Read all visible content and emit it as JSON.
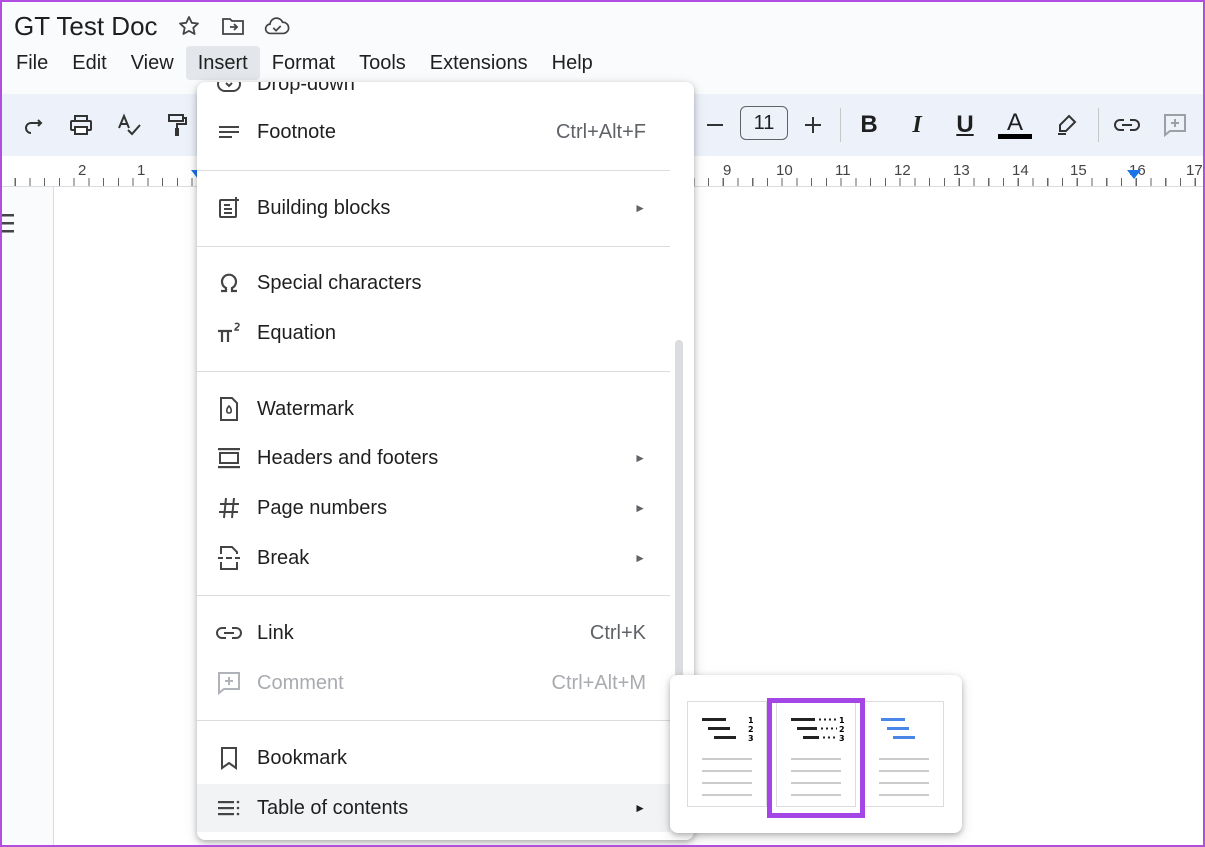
{
  "doc": {
    "title": "GT Test Doc"
  },
  "menubar": [
    "File",
    "Edit",
    "View",
    "Insert",
    "Format",
    "Tools",
    "Extensions",
    "Help"
  ],
  "toolbar": {
    "font_size": "11",
    "bold": "B",
    "italic": "I",
    "underline": "U",
    "text_color_label": "A",
    "text_color": "#000000"
  },
  "ruler": {
    "numbers": [
      "2",
      "1",
      "9",
      "10",
      "11",
      "12",
      "13",
      "14",
      "15",
      "16",
      "17"
    ]
  },
  "insert_menu": {
    "items": [
      {
        "label": "Drop-down",
        "icon": "dropdown-chip-icon"
      },
      {
        "label": "Footnote",
        "shortcut": "Ctrl+Alt+F",
        "icon": "footnote-icon"
      },
      {
        "label": "Building blocks",
        "submenu": "►",
        "icon": "building-blocks-icon"
      },
      {
        "label": "Special characters",
        "icon": "omega-icon"
      },
      {
        "label": "Equation",
        "icon": "pi-squared-icon"
      },
      {
        "label": "Watermark",
        "icon": "watermark-icon"
      },
      {
        "label": "Headers and footers",
        "submenu": "►",
        "icon": "headers-footers-icon"
      },
      {
        "label": "Page numbers",
        "submenu": "►",
        "icon": "hash-icon"
      },
      {
        "label": "Break",
        "submenu": "►",
        "icon": "break-icon"
      },
      {
        "label": "Link",
        "shortcut": "Ctrl+K",
        "icon": "link-icon"
      },
      {
        "label": "Comment",
        "shortcut": "Ctrl+Alt+M",
        "icon": "add-comment-icon",
        "disabled": true
      },
      {
        "label": "Bookmark",
        "icon": "bookmark-icon"
      },
      {
        "label": "Table of contents",
        "submenu": "►",
        "icon": "toc-icon",
        "hovered": true
      }
    ]
  },
  "toc_submenu": {
    "options": [
      {
        "name": "toc-with-page-numbers",
        "numbers": [
          "1",
          "2",
          "3"
        ]
      },
      {
        "name": "toc-dotted-page-numbers",
        "numbers": [
          "1",
          "2",
          "3"
        ],
        "selected": true
      },
      {
        "name": "toc-blue-links"
      }
    ]
  },
  "colors": {
    "accent": "#1a73e8",
    "highlight": "#a445e6",
    "toolbar_bg": "#edf2fa"
  }
}
